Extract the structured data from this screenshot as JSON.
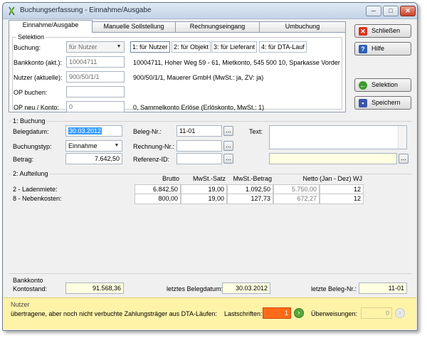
{
  "window": {
    "title": "Buchungserfassung - Einnahme/Ausgabe",
    "minimize": "─",
    "maximize": "□",
    "close": "✕"
  },
  "tabs": [
    "Einnahme/Ausgabe",
    "Manuelle Sollstellung",
    "Rechnungseingang",
    "Umbuchung"
  ],
  "selektion": {
    "group_label": "Selektion",
    "buchung_label": "Buchung:",
    "buchung_value": "für Nutzer",
    "bankkonto_label": "Bankkonto (akt.):",
    "bankkonto_value": "10004711",
    "nutzer_label": "Nutzer (aktuelle):",
    "nutzer_value": "900/50/1/1",
    "op_buchen_label": "OP buchen:",
    "op_buchen_value": "",
    "op_neu_label": "OP neu / Konto:",
    "op_neu_value": "0",
    "filter_buttons": [
      "1: für Nutzer",
      "2: für Objekt",
      "3: für Lieferant",
      "4: für DTA-Lauf"
    ],
    "bankkonto_info": "10004711,  Hoher Weg 59 - 61,  Mietkonto,  545 500 10,  Sparkasse Vorder",
    "nutzer_info": "900/50/1/1,  Mauerer GmbH  (MwSt.: ja,  ZV: ja)",
    "konto_info": "0,  Sammelkonto Erlöse  (Erlöskonto,  MwSt.: 1)"
  },
  "side_buttons": {
    "schliessen": "Schließen",
    "hilfe": "Hilfe",
    "selektion": "Selektion",
    "speichern": "Speichern"
  },
  "buchung": {
    "group_label": "1: Buchung",
    "belegdatum_label": "Belegdatum:",
    "belegdatum_value": "30.03.2012",
    "buchungstyp_label": "Buchungstyp:",
    "buchungstyp_value": "Einnahme",
    "betrag_label": "Betrag:",
    "betrag_value": "7.642,50",
    "belegnr_label": "Beleg-Nr.:",
    "belegnr_value": "11-01",
    "rechnungnr_label": "Rechnung-Nr.:",
    "rechnungnr_value": "",
    "referenz_label": "Referenz-ID:",
    "referenz_value": "",
    "text_label": "Text:",
    "text_value": "",
    "dots": "..."
  },
  "aufteilung": {
    "group_label": "2: Aufteilung",
    "headers": [
      "Brutto",
      "MwSt.-Satz",
      "MwSt.-Betrag",
      "Netto",
      "(Jan - Dez) WJ"
    ],
    "rows": [
      {
        "label": "2 - Ladenmiete:",
        "brutto": "6.842,50",
        "satz": "19,00",
        "betrag": "1.092,50",
        "netto": "5.750,00",
        "wj": "12"
      },
      {
        "label": "8 - Nebenkosten:",
        "brutto": "800,00",
        "satz": "19,00",
        "betrag": "127,73",
        "netto": "672,27",
        "wj": "12"
      }
    ]
  },
  "bankkonto_footer": {
    "group_label": "Bankkonto",
    "kontostand_label": "Kontostand:",
    "kontostand_value": "91.568,36",
    "letztes_datum_label": "letztes Belegdatum:",
    "letztes_datum_value": "30.03.2012",
    "letzte_nr_label": "letzte Beleg-Nr.:",
    "letzte_nr_value": "11-01"
  },
  "nutzer_footer": {
    "group_label": "Nutzer",
    "info_text": "übertragene, aber noch nicht verbuchte Zahlungsträger aus DTA-Läufen:",
    "lastschriften_label": "Lastschriften:",
    "lastschriften_value": "1",
    "ueberweisungen_label": "Überweisungen:",
    "ueberweisungen_value": "0"
  },
  "colors": {
    "accent": "#3399ff",
    "highlight": "#ff6a1a",
    "footer_bg": "#fff3a8",
    "yellow_field": "#ffffe1"
  }
}
